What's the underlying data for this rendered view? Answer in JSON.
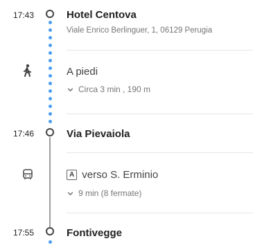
{
  "stops": [
    {
      "time": "17:43",
      "name": "Hotel Centova",
      "address": "Viale Enrico Berlinguer, 1, 06129 Perugia"
    },
    {
      "time": "17:46",
      "name": "Via Pievaiola"
    },
    {
      "time": "17:55",
      "name": "Fontivegge"
    }
  ],
  "segments": {
    "walk": {
      "label": "A piedi",
      "detail": "Circa 3 min , 190 m",
      "icon": "walking-person-icon"
    },
    "bus": {
      "line": "A",
      "direction": "verso S. Erminio",
      "detail": "9 min (8 fermate)",
      "icon": "bus-icon"
    }
  },
  "colors": {
    "walk_dots": "#4a9df0",
    "transit_line": "#9e9e9e"
  }
}
